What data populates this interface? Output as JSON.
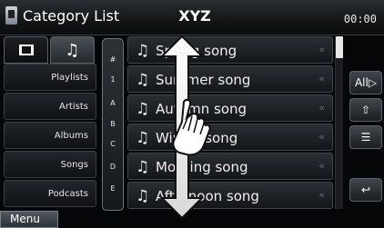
{
  "header": {
    "title": "Category List",
    "center_title": "XYZ",
    "clock": "00:00",
    "icon": "media-device-icon"
  },
  "mode_tabs": [
    {
      "name": "video-tab",
      "icon": "film-icon"
    },
    {
      "name": "music-tab",
      "icon": "music-note-icon"
    }
  ],
  "categories": [
    "Playlists",
    "Artists",
    "Albums",
    "Songs",
    "Podcasts"
  ],
  "alpha_index": [
    "#",
    "1",
    "A",
    "B",
    "C",
    "D",
    "E"
  ],
  "songs": [
    "Spring song",
    "Summer song",
    "Autumn song",
    "Winter song",
    "Morning song",
    "Afternoon song"
  ],
  "right_buttons": {
    "all": "All",
    "icon_2": "multi-level-icon",
    "icon_3": "search-list-icon",
    "back": "back-arrow-icon"
  },
  "footer": {
    "menu": "Menu"
  },
  "gesture": {
    "hint": "scroll-gesture"
  }
}
